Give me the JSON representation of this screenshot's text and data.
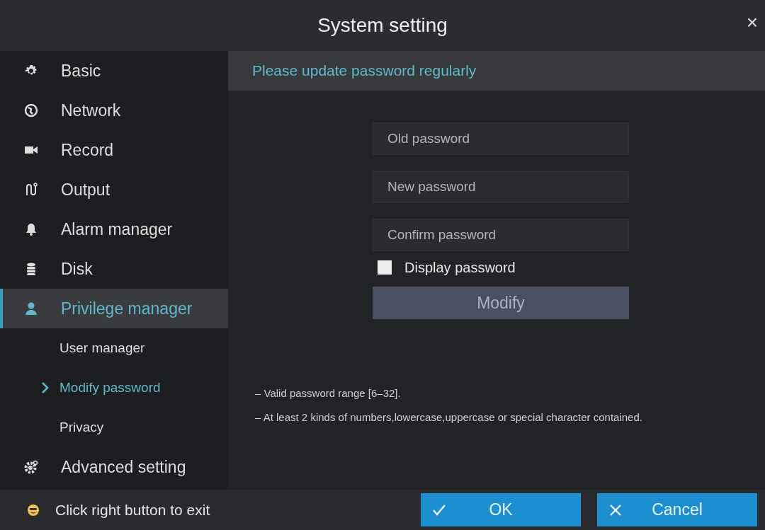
{
  "window": {
    "title": "System setting",
    "close": "×"
  },
  "sidebar": {
    "items": [
      {
        "label": "Basic",
        "selected": false
      },
      {
        "label": "Network",
        "selected": false
      },
      {
        "label": "Record",
        "selected": false
      },
      {
        "label": "Output",
        "selected": false
      },
      {
        "label": "Alarm manager",
        "selected": false
      },
      {
        "label": "Disk",
        "selected": false
      },
      {
        "label": "Privilege manager",
        "selected": true,
        "children": [
          {
            "label": "User manager",
            "selected": false
          },
          {
            "label": "Modify password",
            "selected": true
          },
          {
            "label": "Privacy",
            "selected": false
          }
        ]
      },
      {
        "label": "Advanced setting",
        "selected": false
      }
    ]
  },
  "panel": {
    "heading": "Please update password regularly",
    "fields": [
      {
        "placeholder": "Old password"
      },
      {
        "placeholder": "New password"
      },
      {
        "placeholder": "Confirm password"
      }
    ],
    "display_password": {
      "label": "Display password",
      "checked": false
    },
    "modify_button": "Modify",
    "tips": [
      "– Valid password range [6–32].",
      "– At least 2 kinds of numbers,lowercase,uppercase or special character contained."
    ]
  },
  "footer": {
    "hint": "Click right button to exit",
    "buttons": [
      {
        "kind": "ok",
        "label": "OK"
      },
      {
        "kind": "cancel",
        "label": "Cancel"
      }
    ]
  }
}
